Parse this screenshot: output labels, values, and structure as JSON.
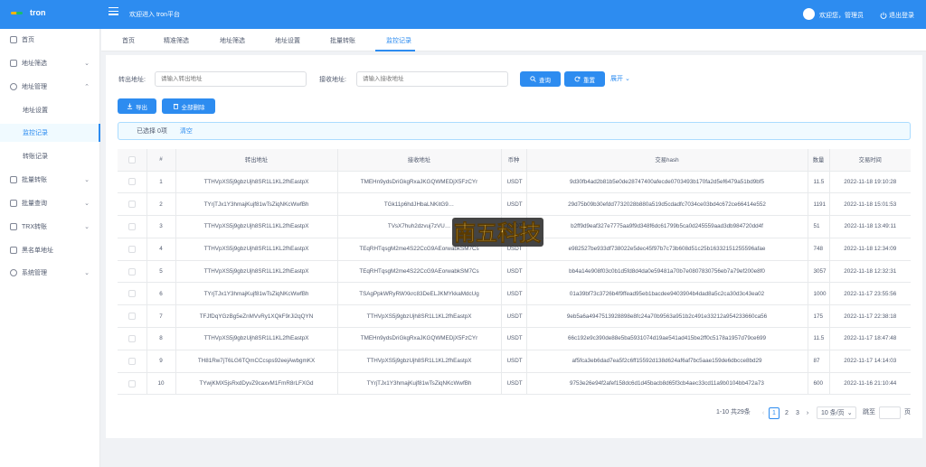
{
  "app": {
    "logo": "tron",
    "welcome": "欢迎进入 tron平台",
    "greeting": "欢迎您，管理员",
    "logout": "退出登录"
  },
  "sidebar": {
    "items": [
      {
        "label": "首页",
        "icon": "home-icon"
      },
      {
        "label": "地址筛选",
        "icon": "tag-icon"
      },
      {
        "label": "地址管理",
        "icon": "user-icon"
      },
      {
        "label": "地址设置"
      },
      {
        "label": "监控记录"
      },
      {
        "label": "转账记录"
      },
      {
        "label": "批量转账",
        "icon": "list-icon"
      },
      {
        "label": "批量查询",
        "icon": "list-icon"
      },
      {
        "label": "TRX转账",
        "icon": "list-icon"
      },
      {
        "label": "黑名单地址",
        "icon": "doc-icon"
      },
      {
        "label": "系统管理",
        "icon": "gear-icon"
      }
    ]
  },
  "tabs": [
    "首页",
    "精准筛选",
    "地址筛选",
    "地址设置",
    "批量转账",
    "监控记录"
  ],
  "filter": {
    "from_label": "转出地址:",
    "from_placeholder": "请输入转出地址",
    "to_label": "接收地址:",
    "to_placeholder": "请输入接收地址",
    "search": "查询",
    "reset": "重置",
    "expand": "展开"
  },
  "actions": {
    "export": "导出",
    "delete_all": "全部删除"
  },
  "selection": {
    "text": "已选择 0项",
    "clear": "清空"
  },
  "table": {
    "headers": [
      "#",
      "转出地址",
      "接收地址",
      "币种",
      "交易hash",
      "数量",
      "交易时间"
    ],
    "rows": [
      [
        "1",
        "TTHVpXS5j9gbzUjh8SR1L1KL2fhEastpX",
        "TMEHn9ydsDriGkgRxaJKGQWMEDjX5FzCYr",
        "USDT",
        "9d30fb4ad2b81b5e0de28747400afecde0703493b170fa2d5ef6479a51bd9bf5",
        "11.5",
        "2022-11-18 19:10:28"
      ],
      [
        "2",
        "TYrjTJx1Y3hmajKujf81wTsZiqNKcWwfBh",
        "TGk11p6hdJHbaLNKitG9…",
        "USDT",
        "29d75b09b30efdd7732028b880a519d5cdadfc7034ce03bd4c672ce66414e552",
        "1191",
        "2022-11-18 15:01:53"
      ],
      [
        "3",
        "TTHVpXS5j9gbzUjh8SR1L1KL2fhEastpX",
        "TVsX7huh2dzvuj7zVU…",
        "USDT",
        "b2ff9d9eaf327e7775aa9f9d348f6dc61799b5ca0d245559aad3db984720dd4f",
        "51",
        "2022-11-18 13:49:11"
      ],
      [
        "4",
        "TTHVpXS5j9gbzUjh8SR1L1KL2fhEastpX",
        "TEqRHTqsgM2me4S22CcG9AEorwabkSM7Cs",
        "USDT",
        "e982527be933df738022e5dec45f97b7c73b608d51c25b16332151255596afae",
        "748",
        "2022-11-18 12:34:09"
      ],
      [
        "5",
        "TTHVpXS5j9gbzUjh8SR1L1KL2fhEastpX",
        "TEqRHTqsgM2me4S22CcG9AEorwabkSM7Cs",
        "USDT",
        "bb4a14e908f03c0b1d5fd8d4da0e59481a70b7e0807830756eb7a79ef200e8f0",
        "3057",
        "2022-11-18 12:32:31"
      ],
      [
        "6",
        "TYrjTJx1Y3hmajKujf81wTsZiqNKcWwfBh",
        "TSAgPpkWRyRWXkrc83DeELJKMYkkaMdcUg",
        "USDT",
        "01a39bf73c3726b4f9ffead95eb1bacdee9403904b4dad8a5c2ca30d3c43ea02",
        "1000",
        "2022-11-17 23:55:56"
      ],
      [
        "7",
        "TFJfDqYGzBg5eZnMVvRy1XQkF9rJi2qQYN",
        "TTHVpXS5j9gbzUjh8SR1L1KL2fhEastpX",
        "USDT",
        "9eb5a6a4947513928898e8fc24a70b9563a951b2c491e33212a954233660ca56",
        "175",
        "2022-11-17 22:38:18"
      ],
      [
        "8",
        "TTHVpXS5j9gbzUjh8SR1L1KL2fhEastpX",
        "TMEHn9ydsDriGkgRxaJKGQWMEDjX5FzCYr",
        "USDT",
        "66c192e9c390de88e5ba5931074d19ae541ad415be2ff0c5178a1957d79ce699",
        "11.5",
        "2022-11-17 18:47:48"
      ],
      [
        "9",
        "TH81Rw7jT6LG6TQmCCcsps92eejAwbgmKX",
        "TTHVpXS5j9gbzUjh8SR1L1KL2fhEastpX",
        "USDT",
        "af5fca3eb6dad7ea5f2c6ff15592d138d624af6af7bc5aae159de6dbcce8bd29",
        "87",
        "2022-11-17 14:14:03"
      ],
      [
        "10",
        "TYwjKMX5jsRxdDyvZ9caxvM1FmR8rLFXGd",
        "TYrjTJx1Y3hmajKujf81wTsZiqNKcWwfBh",
        "USDT",
        "9753e26e94f2afef158dc6d1d45bacb8d65f3cb4aec33cd11a9b0104bb472a73",
        "600",
        "2022-11-16 21:10:44"
      ]
    ]
  },
  "pagination": {
    "summary": "1-10 共29条",
    "pages": [
      "1",
      "2",
      "3"
    ],
    "current": "1",
    "page_size": "10 条/页",
    "goto": "跳至",
    "page_unit": "页"
  },
  "watermark": {
    "text": "南五科技"
  },
  "colors": {
    "primary": "#2d8cf0",
    "sidebar_active_bg": "#f0faff"
  }
}
